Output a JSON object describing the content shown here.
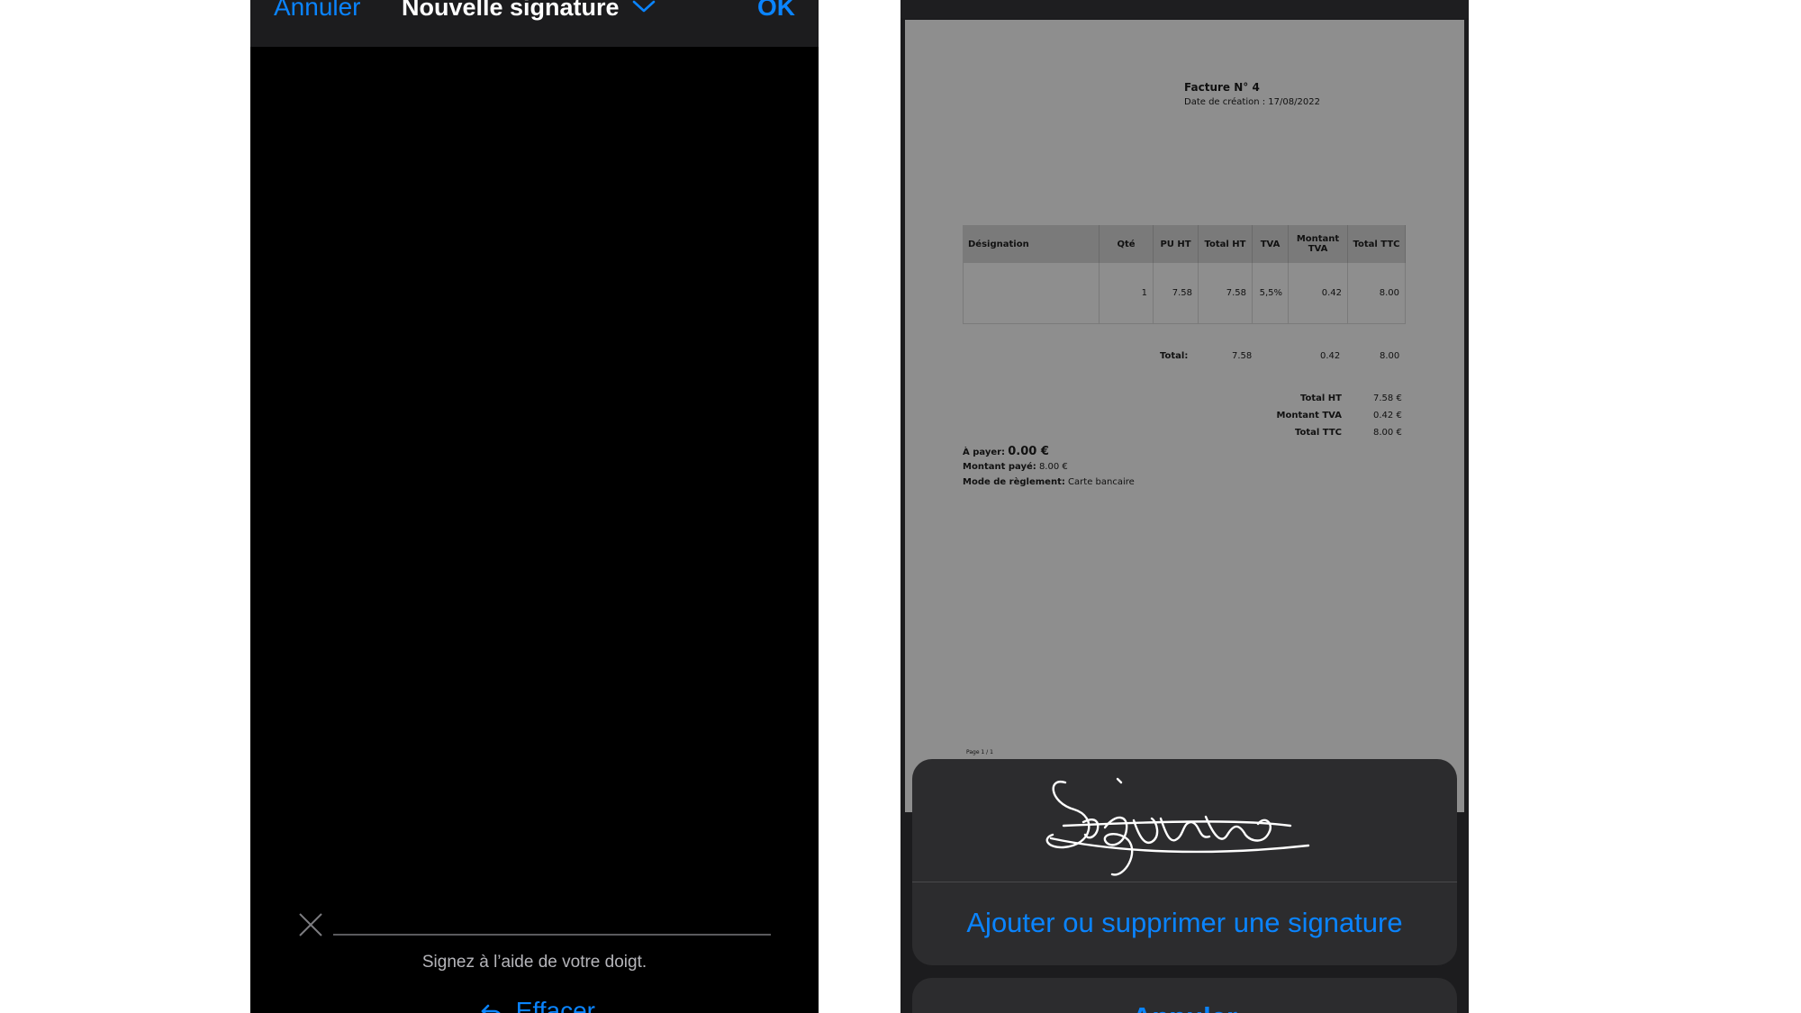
{
  "left_screen": {
    "nav": {
      "cancel_label": "Annuler",
      "title": "Nouvelle signature",
      "ok_label": "OK"
    },
    "hint": "Signez à l’aide de votre doigt.",
    "erase_label": "Effacer",
    "icons": [
      "chevron-down-icon",
      "close-icon",
      "undo-icon"
    ]
  },
  "right_screen": {
    "invoice": {
      "title": "Facture N° 4",
      "date": "Date de création : 17/08/2022",
      "table": {
        "headers": [
          "Désignation",
          "Qté",
          "PU HT",
          "Total HT",
          "TVA",
          "Montant TVA",
          "Total TTC"
        ],
        "row": [
          "",
          "1",
          "7.58",
          "7.58",
          "5,5%",
          "0.42",
          "8.00"
        ],
        "total_label": "Total:",
        "total_row": [
          "7.58",
          "0.42",
          "8.00"
        ]
      },
      "summary": [
        {
          "label": "Total HT",
          "value": "7.58 €"
        },
        {
          "label": "Montant TVA",
          "value": "0.42 €"
        },
        {
          "label": "Total TTC",
          "value": "8.00 €"
        }
      ],
      "payment": {
        "to_pay_label": "À payer:",
        "to_pay_value": "0.00 €",
        "paid_label": "Montant payé:",
        "paid_value": "8.00 €",
        "method_label": "Mode de règlement:",
        "method_value": "Carte bancaire"
      },
      "page_footer": "Page 1 / 1"
    },
    "sheet": {
      "action_label": "Ajouter ou supprimer une signature",
      "cancel_label": "Annuler"
    }
  },
  "colors": {
    "accent": "#0a84ff",
    "sheet_bg": "#2c2c2e",
    "document_bg": "#8e8e8e"
  }
}
